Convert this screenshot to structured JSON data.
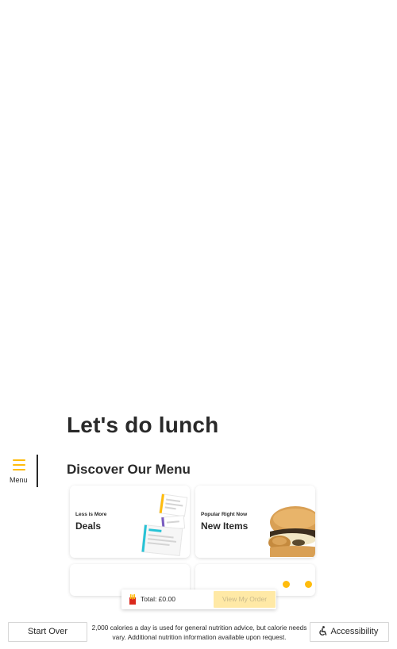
{
  "side_menu": {
    "label": "Menu"
  },
  "headline": "Let's do lunch",
  "section_title": "Discover Our Menu",
  "cards": [
    {
      "eyebrow": "Less is More",
      "title": "Deals"
    },
    {
      "eyebrow": "Popular Right Now",
      "title": "New Items"
    }
  ],
  "order_bar": {
    "total": "Total: £0.00",
    "view_order": "View My Order"
  },
  "footer": {
    "start_over": "Start Over",
    "disclaimer": "2,000 calories a day is used for general nutrition advice, but calorie needs vary. Additional nutrition information available upon request.",
    "accessibility": "Accessibility"
  },
  "colors": {
    "accent": "#ffbc0d",
    "disabled_button": "#ffe9a6",
    "text": "#292929"
  }
}
